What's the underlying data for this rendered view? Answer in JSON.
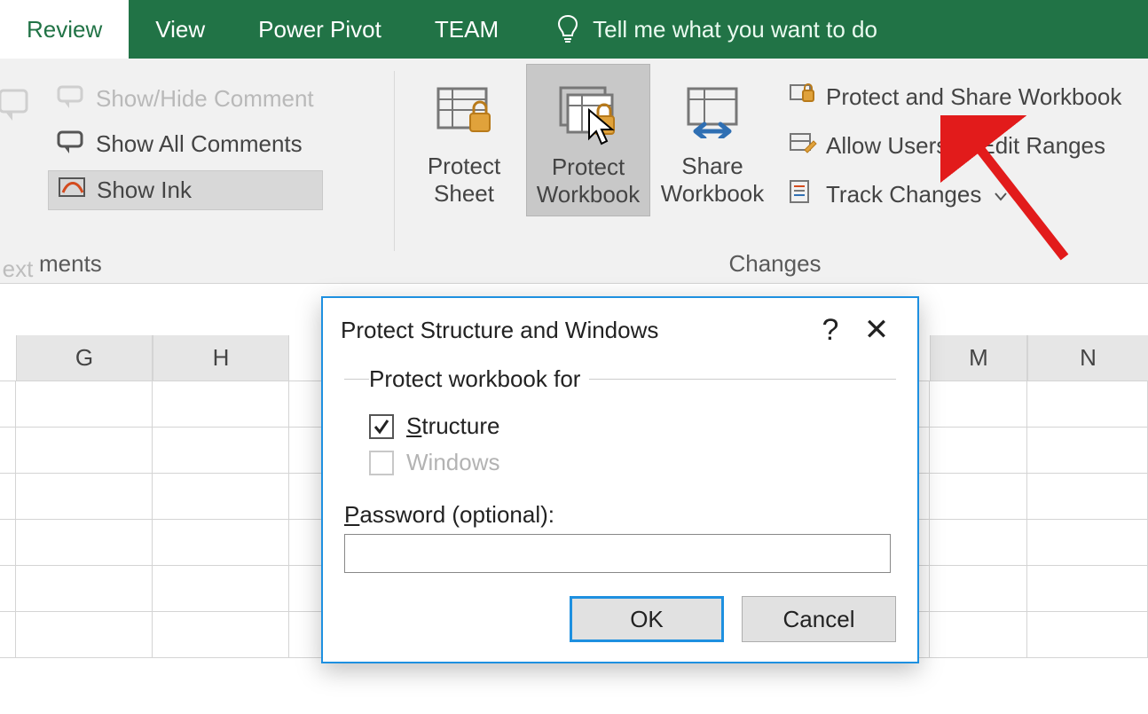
{
  "tabs": {
    "review": "Review",
    "view": "View",
    "powerpivot": "Power Pivot",
    "team": "TEAM",
    "tellme": "Tell me what you want to do"
  },
  "ribbon": {
    "partial_group_label": "ments",
    "partial_delete_label": "ext",
    "comments": {
      "show_hide": "Show/Hide Comment",
      "show_all": "Show All Comments",
      "show_ink": "Show Ink"
    },
    "changes_group_label": "Changes",
    "protect_sheet_l1": "Protect",
    "protect_sheet_l2": "Sheet",
    "protect_workbook_l1": "Protect",
    "protect_workbook_l2": "Workbook",
    "share_workbook_l1": "Share",
    "share_workbook_l2": "Workbook",
    "protect_share": "Protect and Share Workbook",
    "allow_users": "Allow Users to Edit Ranges",
    "track_changes": "Track Changes"
  },
  "columns": {
    "g": "G",
    "h": "H",
    "m": "M",
    "n": "N"
  },
  "dialog": {
    "title": "Protect Structure and Windows",
    "help": "?",
    "close": "✕",
    "legend": "Protect workbook for",
    "structure_prefix": "S",
    "structure_rest": "tructure",
    "windows": "Windows",
    "password_label_prefix": "P",
    "password_label_rest": "assword (optional):",
    "password_value": "",
    "ok": "OK",
    "cancel": "Cancel"
  }
}
